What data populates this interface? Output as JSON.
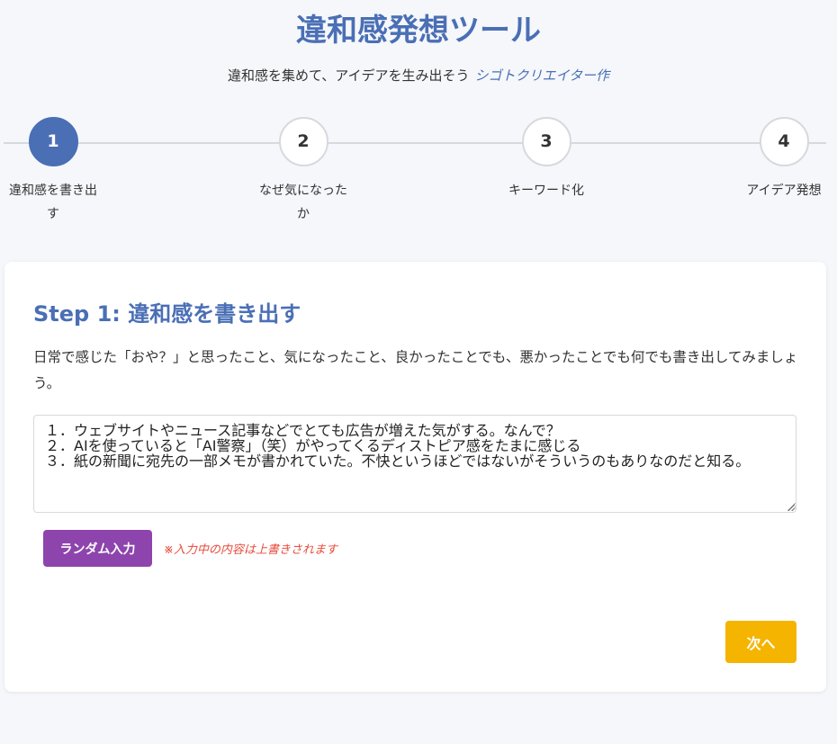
{
  "header": {
    "title": "違和感発想ツール",
    "subtitle": "違和感を集めて、アイデアを生み出そう",
    "author": "シゴトクリエイター作"
  },
  "stepper": {
    "current": 1,
    "steps": [
      {
        "number": "1",
        "label": "違和感を書き出す"
      },
      {
        "number": "2",
        "label": "なぜ気になったか"
      },
      {
        "number": "3",
        "label": "キーワード化"
      },
      {
        "number": "4",
        "label": "アイデア発想"
      }
    ]
  },
  "card": {
    "title": "Step 1: 違和感を書き出す",
    "description": "日常で感じた「おや？」と思ったこと、気になったこと、良かったことでも、悪かったことでも何でも書き出してみましょう。",
    "textarea_value": "１．ウェブサイトやニュース記事などでとても広告が増えた気がする。なんで？\n２．AIを使っていると「AI警察」（笑）がやってくるディストピア感をたまに感じる\n３．紙の新聞に宛先の一部メモが書かれていた。不快というほどではないがそういうのもありなのだと知る。",
    "random_button": "ランダム入力",
    "warning": "※入力中の内容は上書きされます",
    "next_button": "次へ"
  },
  "colors": {
    "primary": "#4a6fb5",
    "random_button": "#8e44ad",
    "next_button": "#f5b400",
    "warning": "#e74c3c",
    "background": "#f5f7fa"
  }
}
